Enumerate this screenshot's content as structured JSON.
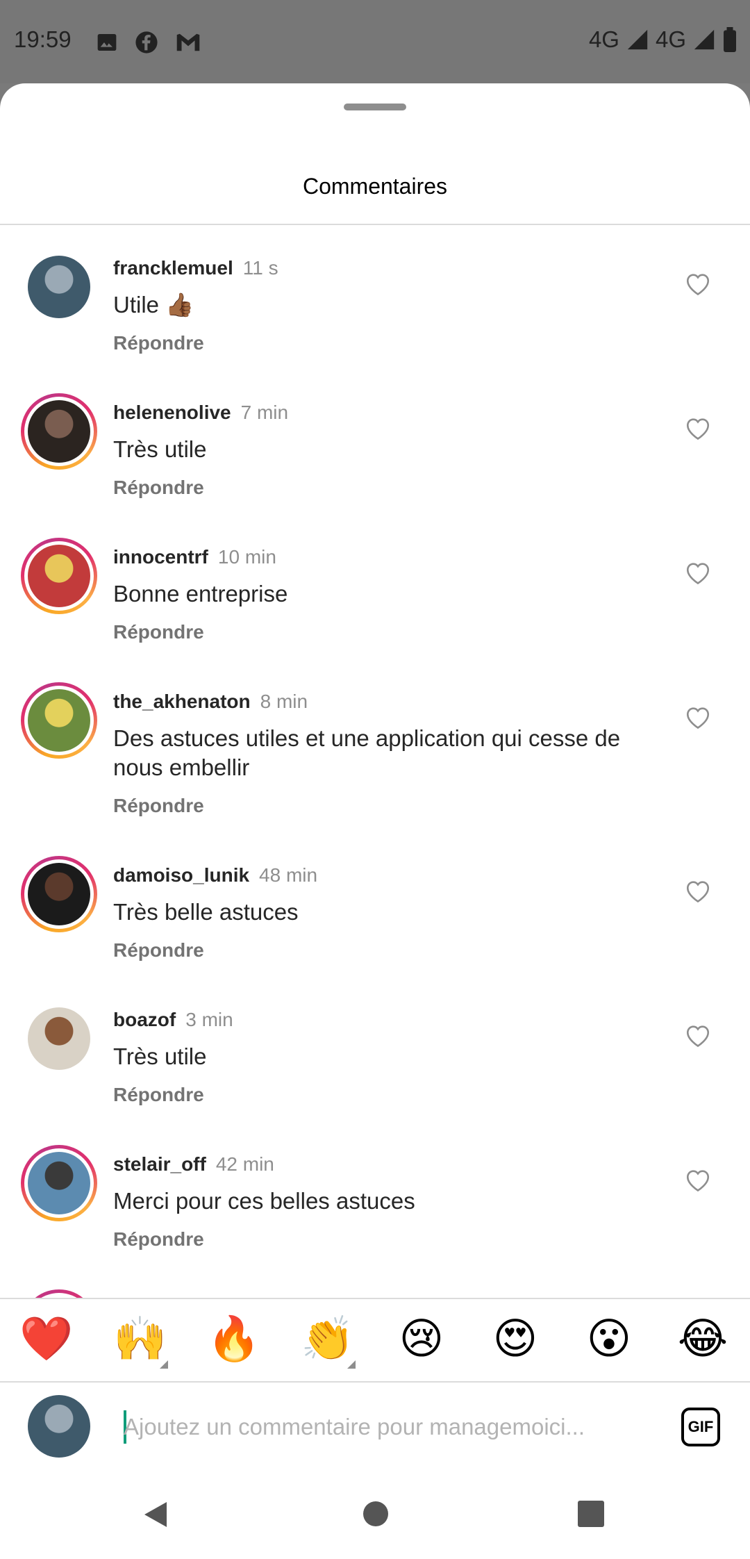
{
  "status_bar": {
    "time": "19:59",
    "network_1": "4G",
    "network_2": "4G",
    "left_icons": [
      "image-icon",
      "facebook-icon",
      "gmail-icon"
    ],
    "right_icons": [
      "signal-icon",
      "signal-icon",
      "battery-icon"
    ]
  },
  "sheet": {
    "title": "Commentaires"
  },
  "comments": [
    {
      "username": "francklemuel",
      "time": "11 s",
      "text": "Utile 👍🏾",
      "reply_label": "Répondre",
      "has_story": false,
      "avatar_colors": [
        "#3f5a6b",
        "#9aa9b5"
      ]
    },
    {
      "username": "helenenolive",
      "time": "7 min",
      "text": "Très utile",
      "reply_label": "Répondre",
      "has_story": true,
      "avatar_colors": [
        "#2b2420",
        "#7a5d50"
      ]
    },
    {
      "username": "innocentrf",
      "time": "10 min",
      "text": "Bonne entreprise",
      "reply_label": "Répondre",
      "has_story": true,
      "avatar_colors": [
        "#c23b3b",
        "#e8c65a"
      ]
    },
    {
      "username": "the_akhenaton",
      "time": "8 min",
      "text": "Des astuces utiles et une application qui cesse de nous embellir",
      "reply_label": "Répondre",
      "has_story": true,
      "avatar_colors": [
        "#6b8c3e",
        "#e3d15c"
      ]
    },
    {
      "username": "damoiso_lunik",
      "time": "48 min",
      "text": "Très belle astuces",
      "reply_label": "Répondre",
      "has_story": true,
      "avatar_colors": [
        "#1b1b1b",
        "#5b3a2c"
      ]
    },
    {
      "username": "boazof",
      "time": "3 min",
      "text": "Très utile",
      "reply_label": "Répondre",
      "has_story": false,
      "avatar_colors": [
        "#d9d2c6",
        "#8a5a3b"
      ]
    },
    {
      "username": "stelair_off",
      "time": "42 min",
      "text": "Merci pour ces belles astuces",
      "reply_label": "Répondre",
      "has_story": true,
      "avatar_colors": [
        "#5c8bb0",
        "#3a3a3a"
      ]
    }
  ],
  "reactions": [
    {
      "emoji": "❤️",
      "name": "red-heart",
      "has_more": false
    },
    {
      "emoji": "🙌",
      "name": "raising-hands",
      "has_more": true
    },
    {
      "emoji": "🔥",
      "name": "fire",
      "has_more": false
    },
    {
      "emoji": "👏",
      "name": "clapping-hands",
      "has_more": true
    },
    {
      "emoji": "😢",
      "name": "crying-face",
      "has_more": false
    },
    {
      "emoji": "😍",
      "name": "heart-eyes",
      "has_more": false
    },
    {
      "emoji": "😮",
      "name": "surprised-face",
      "has_more": false
    },
    {
      "emoji": "😂",
      "name": "tears-of-joy",
      "has_more": false
    }
  ],
  "composer": {
    "placeholder": "Ajoutez un commentaire pour managemoici...",
    "gif_label": "GIF",
    "avatar_colors": [
      "#3f5a6b",
      "#9aa9b5"
    ]
  },
  "navigation": {
    "icons": [
      "back-icon",
      "home-icon",
      "recent-apps-icon"
    ]
  },
  "colors": {
    "story_ring": [
      "#f9a825",
      "#e1306c",
      "#c13584"
    ],
    "text_primary": "#262626",
    "text_secondary": "#8e8e8e"
  }
}
